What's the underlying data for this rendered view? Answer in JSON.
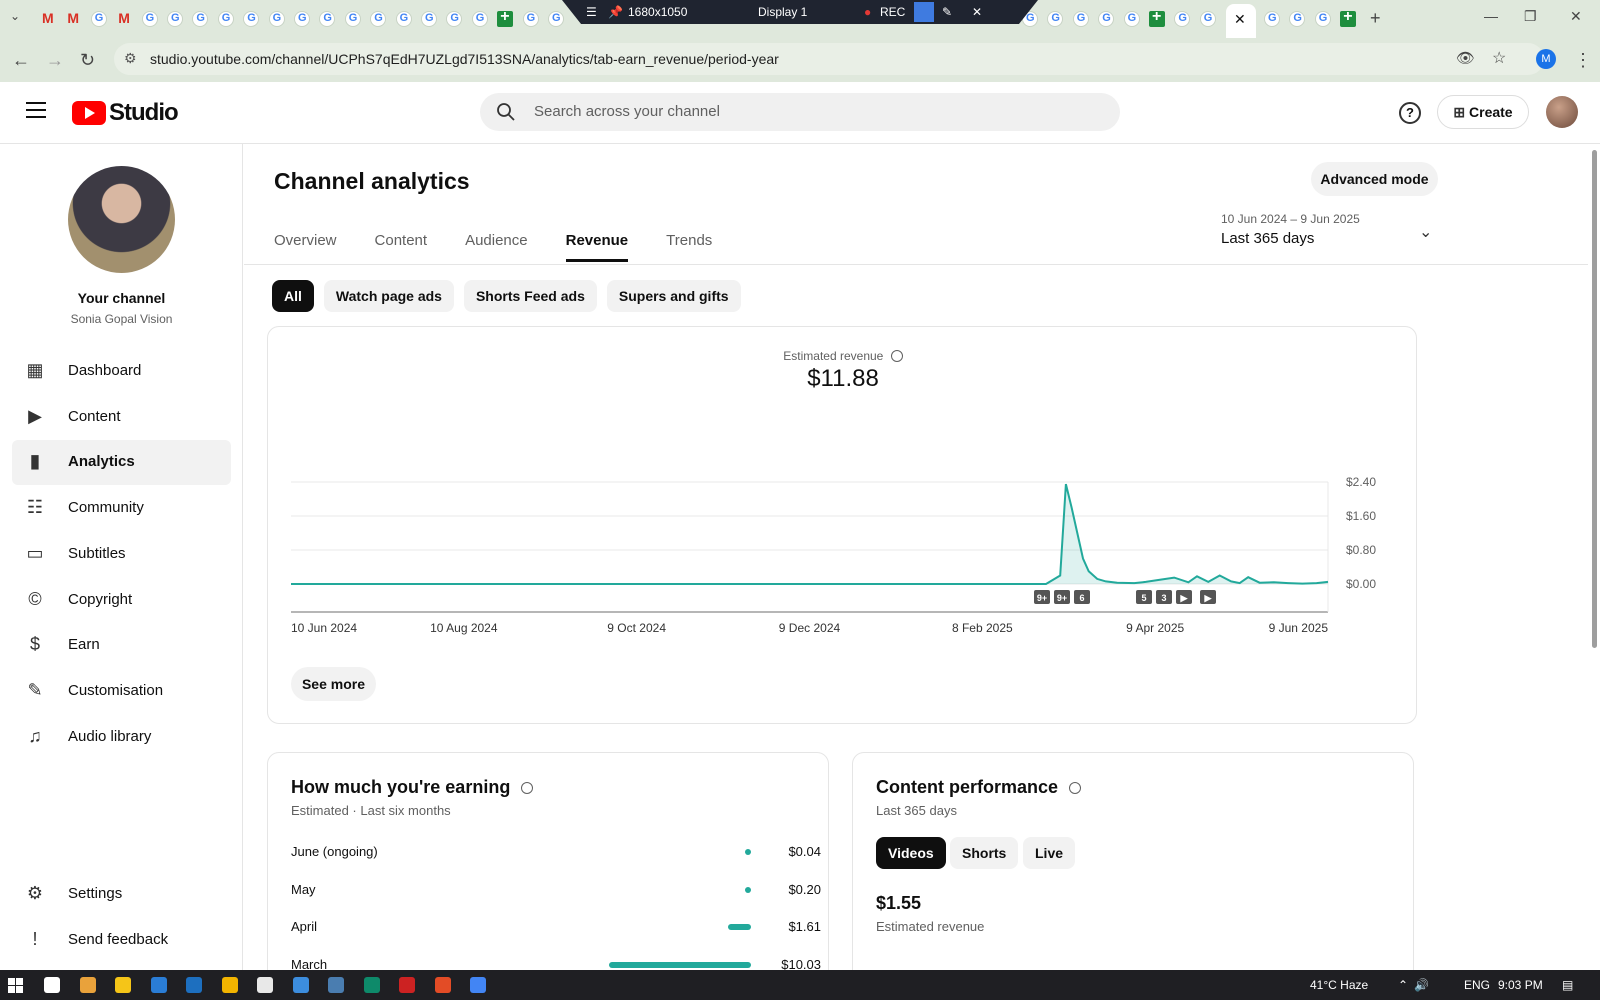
{
  "browser": {
    "recorder": {
      "resolution": "1680x1050",
      "display": "Display 1",
      "rec_label": "REC"
    },
    "url": "studio.youtube.com/channel/UCPhS7qEdH7UZLgd7I513SNA/analytics/tab-earn_revenue/period-year",
    "profile_initial": "M"
  },
  "header": {
    "logo_text": "Studio",
    "search_placeholder": "Search across your channel",
    "create_label": "Create"
  },
  "sidebar": {
    "channel_title": "Your channel",
    "channel_name": "Sonia Gopal Vision",
    "items": [
      {
        "label": "Dashboard",
        "icon": "dashboard-icon"
      },
      {
        "label": "Content",
        "icon": "content-icon"
      },
      {
        "label": "Analytics",
        "icon": "analytics-icon"
      },
      {
        "label": "Community",
        "icon": "community-icon"
      },
      {
        "label": "Subtitles",
        "icon": "subtitles-icon"
      },
      {
        "label": "Copyright",
        "icon": "copyright-icon"
      },
      {
        "label": "Earn",
        "icon": "earn-icon"
      },
      {
        "label": "Customisation",
        "icon": "customisation-icon"
      },
      {
        "label": "Audio library",
        "icon": "audio-library-icon"
      }
    ],
    "bottom_items": [
      {
        "label": "Settings",
        "icon": "settings-icon"
      },
      {
        "label": "Send feedback",
        "icon": "feedback-icon"
      }
    ]
  },
  "main": {
    "title": "Channel analytics",
    "advanced_mode": "Advanced mode",
    "tabs": [
      "Overview",
      "Content",
      "Audience",
      "Revenue",
      "Trends"
    ],
    "active_tab": "Revenue",
    "date_range": "10 Jun 2024 – 9 Jun 2025",
    "date_label": "Last 365 days",
    "chips": [
      "All",
      "Watch page ads",
      "Shorts Feed ads",
      "Supers and gifts"
    ],
    "active_chip": "All",
    "metric_label": "Estimated revenue",
    "metric_value": "$11.88",
    "see_more": "See more",
    "markers": [
      "9+",
      "9+",
      "6",
      "5",
      "3",
      "▶",
      "▶"
    ]
  },
  "chart_data": {
    "type": "area",
    "title": "",
    "xlabel": "",
    "ylabel": "",
    "x_ticks": [
      "10 Jun 2024",
      "10 Aug 2024",
      "9 Oct 2024",
      "9 Dec 2024",
      "8 Feb 2025",
      "9 Apr 2025",
      "9 Jun 2025"
    ],
    "y_ticks": [
      "$2.40",
      "$1.60",
      "$0.80",
      "$0.00"
    ],
    "ylim": [
      0,
      2.4
    ],
    "series": [
      {
        "x": [
          0,
          265,
          270,
          272,
          274,
          276,
          278,
          280,
          283,
          286,
          290,
          296,
          300,
          305,
          310,
          315,
          318,
          322,
          326,
          330,
          333,
          336,
          340,
          345,
          350,
          355,
          360,
          364
        ],
        "values": [
          0,
          0,
          0.2,
          2.35,
          1.8,
          1.2,
          0.6,
          0.3,
          0.12,
          0.06,
          0.03,
          0.02,
          0.05,
          0.1,
          0.15,
          0.04,
          0.18,
          0.05,
          0.2,
          0.06,
          0.02,
          0.16,
          0.03,
          0.04,
          0.02,
          0.01,
          0.02,
          0.05
        ]
      }
    ],
    "color": "#22a99b"
  },
  "earning": {
    "title": "How much you're earning",
    "subtitle": "Estimated · Last six months",
    "rows": [
      {
        "month": "June (ongoing)",
        "value": "$0.04",
        "amount": 0.04
      },
      {
        "month": "May",
        "value": "$0.20",
        "amount": 0.2
      },
      {
        "month": "April",
        "value": "$1.61",
        "amount": 1.61
      },
      {
        "month": "March",
        "value": "$10.03",
        "amount": 10.03
      }
    ]
  },
  "performance": {
    "title": "Content performance",
    "subtitle": "Last 365 days",
    "segments": [
      "Videos",
      "Shorts",
      "Live"
    ],
    "active_segment": "Videos",
    "value": "$1.55",
    "value_label": "Estimated revenue"
  },
  "taskbar": {
    "weather": "41°C  Haze",
    "lang": "ENG",
    "time": "9:03 PM"
  }
}
